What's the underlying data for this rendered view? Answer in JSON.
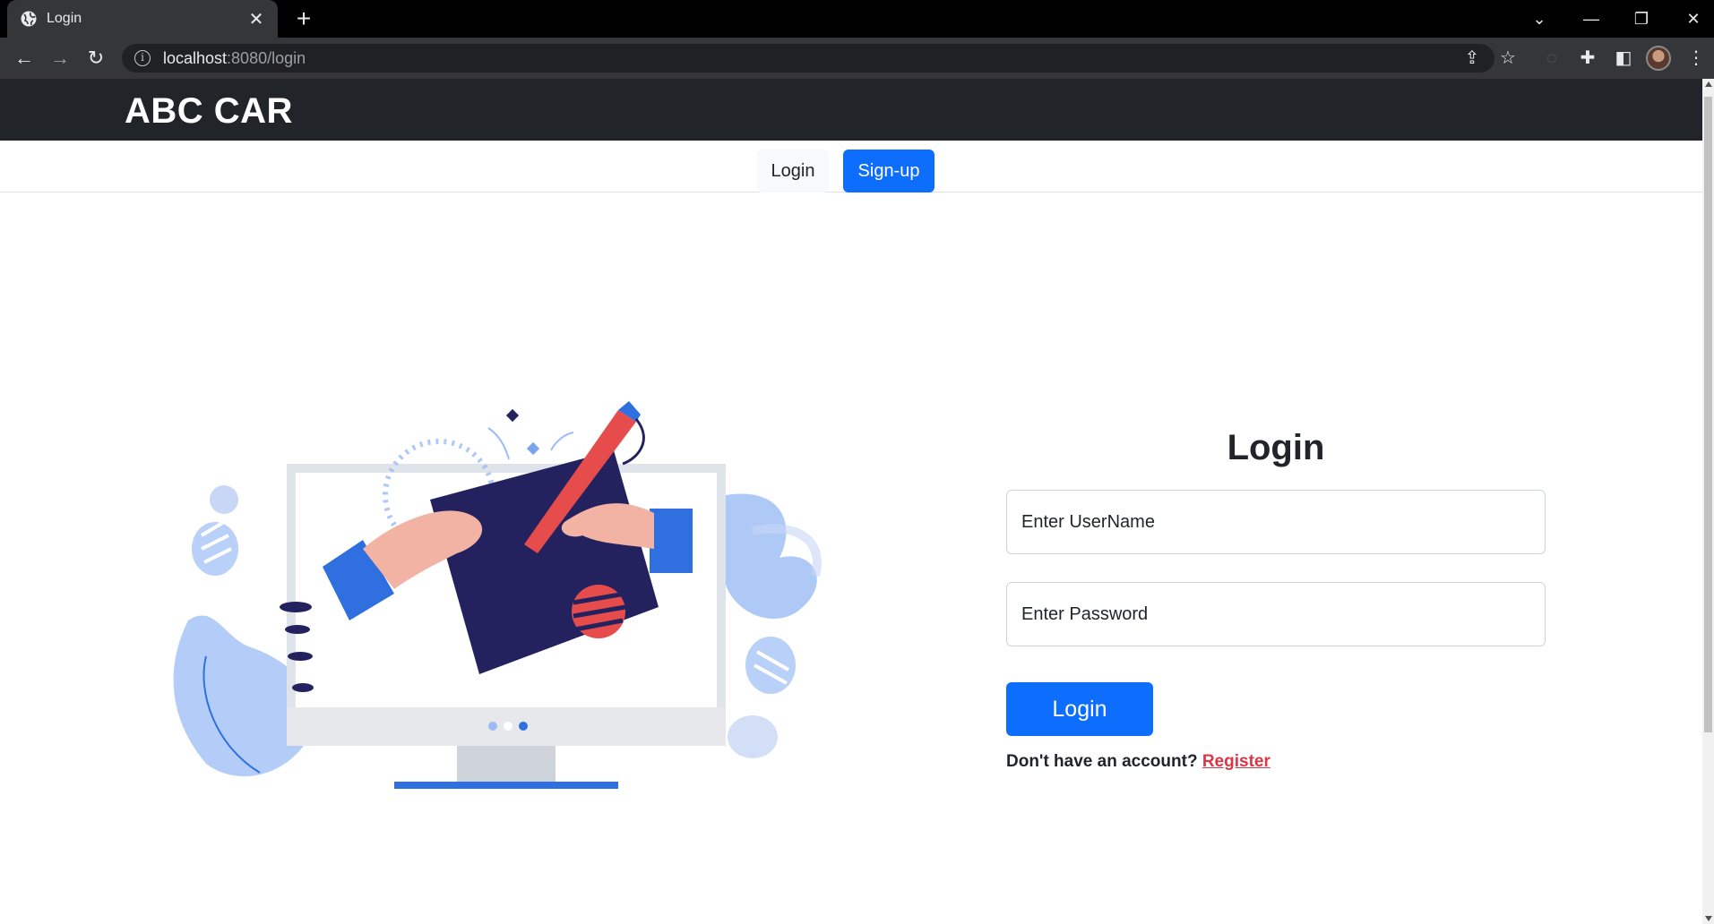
{
  "browser": {
    "tab_title": "Login",
    "url_host": "localhost",
    "url_rest": ":8080/login"
  },
  "navbar": {
    "brand": "ABC CAR"
  },
  "subnav": {
    "login_label": "Login",
    "signup_label": "Sign-up"
  },
  "form": {
    "title": "Login",
    "username_placeholder": "Enter UserName",
    "password_placeholder": "Enter Password",
    "submit_label": "Login",
    "register_prompt": "Don't have an account?",
    "register_link": "Register"
  },
  "colors": {
    "navbar_bg": "#212529",
    "primary": "#0d6efd",
    "danger": "#dc3545",
    "illustration_navy": "#23225f",
    "illustration_blue": "#2f6fe0",
    "illustration_red": "#e74c4c"
  }
}
